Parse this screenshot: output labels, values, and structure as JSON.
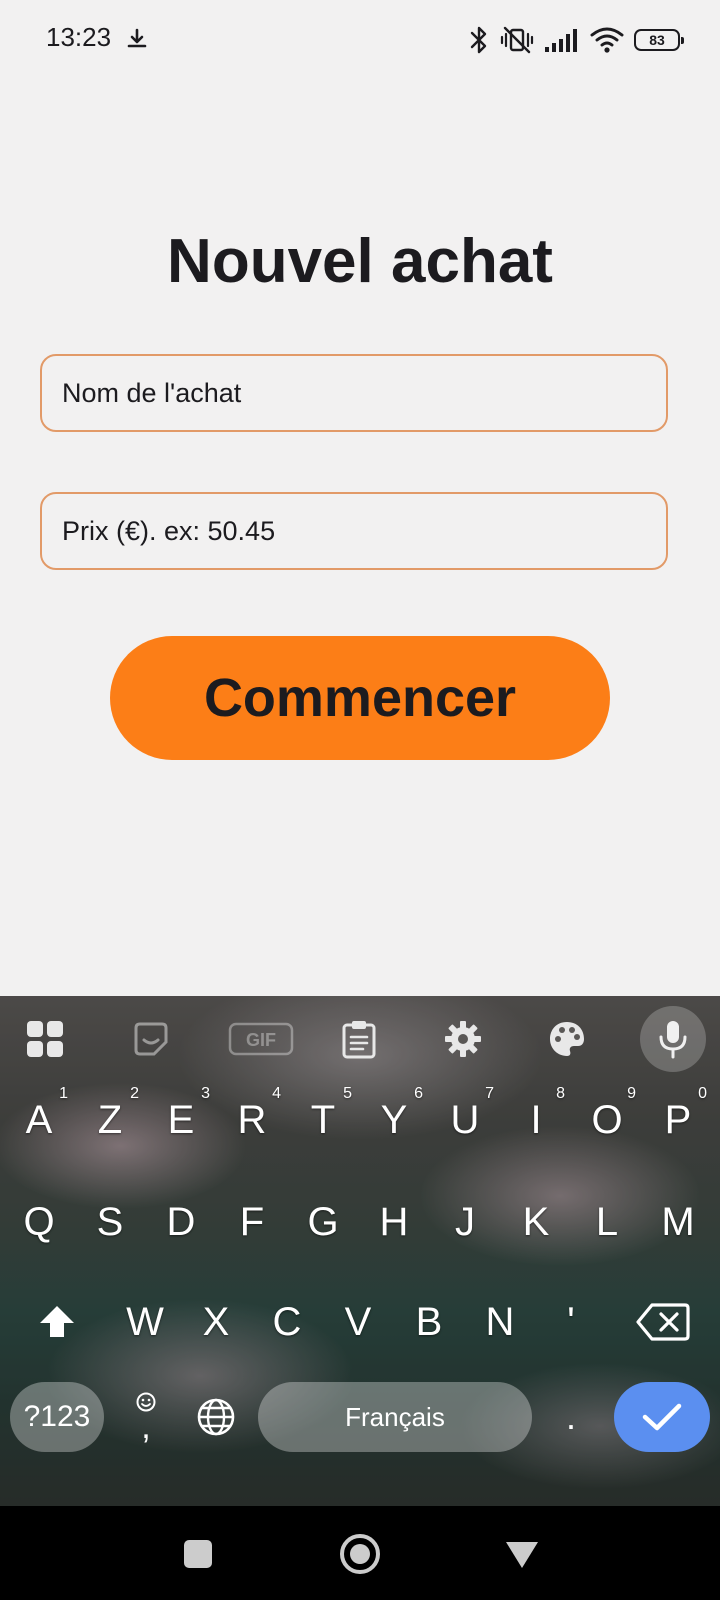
{
  "status_bar": {
    "time": "13:23",
    "battery": "83",
    "icons": [
      "download-icon",
      "bluetooth-icon",
      "vibrate-off-icon",
      "signal-icon",
      "wifi-icon",
      "battery-icon"
    ]
  },
  "form": {
    "title": "Nouvel achat",
    "name_placeholder": "Nom de l'achat",
    "price_placeholder": "Prix (€). ex: 50.45",
    "start_label": "Commencer"
  },
  "colors": {
    "accent": "#fc7e17",
    "field_border": "#e29a68",
    "background": "#f2f1f1",
    "enter_key": "#5b8ff0"
  },
  "keyboard": {
    "toolbar_icons": [
      "apps-grid-icon",
      "sticker-icon",
      "gif-icon",
      "clipboard-icon",
      "settings-icon",
      "palette-icon",
      "microphone-icon"
    ],
    "row1": [
      {
        "key": "A",
        "hint": "1"
      },
      {
        "key": "Z",
        "hint": "2"
      },
      {
        "key": "E",
        "hint": "3"
      },
      {
        "key": "R",
        "hint": "4"
      },
      {
        "key": "T",
        "hint": "5"
      },
      {
        "key": "Y",
        "hint": "6"
      },
      {
        "key": "U",
        "hint": "7"
      },
      {
        "key": "I",
        "hint": "8"
      },
      {
        "key": "O",
        "hint": "9"
      },
      {
        "key": "P",
        "hint": "0"
      }
    ],
    "row2": [
      "Q",
      "S",
      "D",
      "F",
      "G",
      "H",
      "J",
      "K",
      "L",
      "M"
    ],
    "row3": [
      "W",
      "X",
      "C",
      "V",
      "B",
      "N",
      "'"
    ],
    "symbols_label": "?123",
    "emoji_comma": ",",
    "space_label": "Français",
    "period": "."
  },
  "nav_bar": {
    "icons": [
      "recents-square-icon",
      "home-circle-icon",
      "back-triangle-icon"
    ]
  }
}
